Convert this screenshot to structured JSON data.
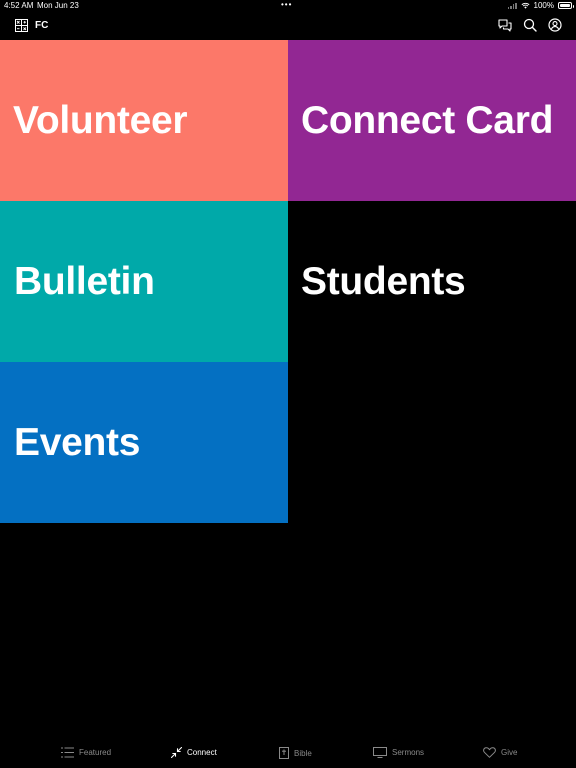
{
  "status_bar": {
    "time": "4:52 AM",
    "date": "Mon Jun 23",
    "dots": "•••",
    "battery": "100%"
  },
  "nav": {
    "app_abbr": "FC",
    "icons": [
      "logo-icon",
      "chat-icon",
      "search-icon",
      "profile-icon"
    ]
  },
  "tiles": [
    {
      "label": "Volunteer",
      "color": "#fc7869"
    },
    {
      "label": "Connect Card",
      "color": "#922793"
    },
    {
      "label": "Bulletin",
      "color": "#00a9a9"
    },
    {
      "label": "Students",
      "color": "#000000"
    },
    {
      "label": "Events",
      "color": "#0470c2"
    }
  ],
  "tabs": [
    {
      "label": "Featured",
      "icon": "list-icon",
      "active": false
    },
    {
      "label": "Connect",
      "icon": "connect-arrows-icon",
      "active": true
    },
    {
      "label": "Bible",
      "icon": "bible-icon",
      "active": false
    },
    {
      "label": "Sermons",
      "icon": "monitor-icon",
      "active": false
    },
    {
      "label": "Give",
      "icon": "heart-icon",
      "active": false
    }
  ],
  "colors": {
    "background": "#000000",
    "tab_inactive": "#8a8a8a",
    "tab_active": "#ffffff"
  }
}
